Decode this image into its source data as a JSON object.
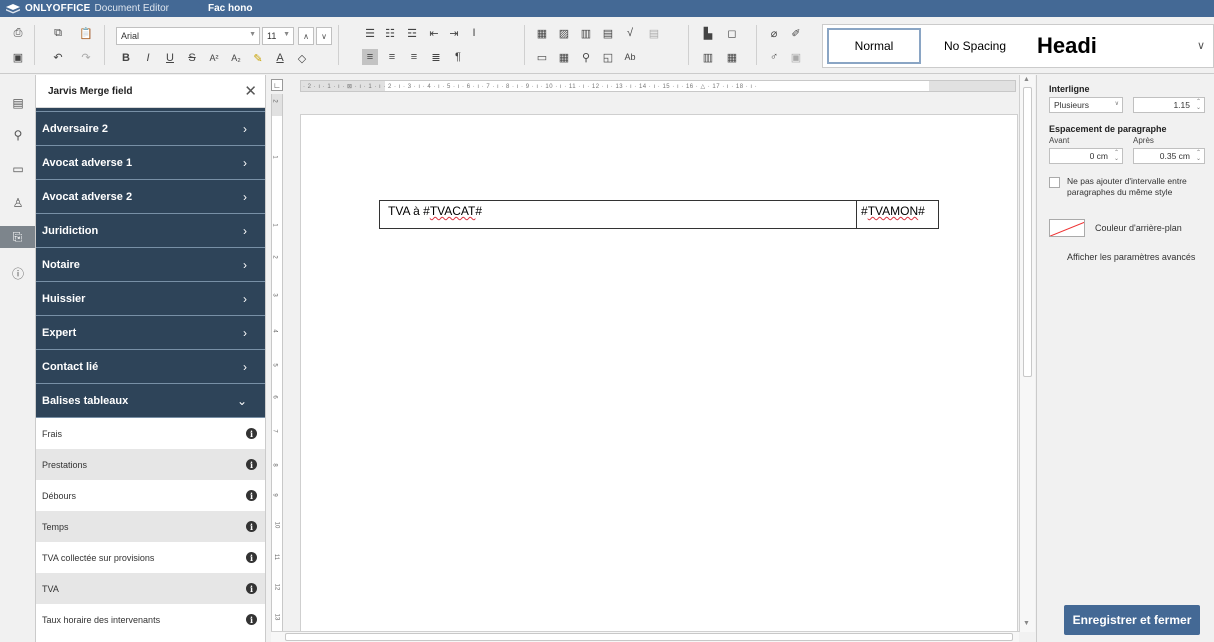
{
  "titlebar": {
    "brand": "ONLYOFFICE",
    "product": "Document Editor",
    "document": "Fac hono"
  },
  "toolbar": {
    "font_name": "Arial",
    "font_size": "11",
    "styles": {
      "normal": "Normal",
      "no_spacing": "No Spacing",
      "heading": "Headi"
    }
  },
  "panel": {
    "title": "Jarvis Merge field",
    "groups": [
      "Adversaire 2",
      "Avocat adverse 1",
      "Avocat adverse 2",
      "Juridiction",
      "Notaire",
      "Huissier",
      "Expert",
      "Contact lié"
    ],
    "expanded_group": "Balises tableaux",
    "items": [
      "Frais",
      "Prestations",
      "Débours",
      "Temps",
      "TVA collectée sur provisions",
      "TVA",
      "Taux horaire des intervenants"
    ]
  },
  "document": {
    "cell1_prefix": "TVA à #",
    "cell1_field": "TVACAT",
    "cell1_suffix": "#",
    "cell2_prefix": "#",
    "cell2_field": "TVAMON",
    "cell2_suffix": "#"
  },
  "ruler": {
    "h_ticks": "· 2 · ı · 1 · ı · ⊠ · ı · 1 · ı · 2 · ı · 3 · ı · 4 · ı · 5 · ı · 6 · ı · 7 · ı · 8 · ı · 9 · ı · 10 · ı · 11 · ı · 12 · ı · 13 · ı · 14 · ı · 15 · ı · 16 · △ · 17 · ı · 18 · ı ·",
    "v_ticks": [
      "2",
      "1",
      "1",
      "2",
      "3",
      "4",
      "5",
      "6",
      "7",
      "8",
      "9",
      "10",
      "11",
      "12",
      "13"
    ]
  },
  "right_panel": {
    "line_spacing_label": "Interligne",
    "line_spacing_mode": "Plusieurs",
    "line_spacing_value": "1.15",
    "paragraph_spacing_label": "Espacement de paragraphe",
    "before_label": "Avant",
    "after_label": "Après",
    "before_value": "0 cm",
    "after_value": "0.35 cm",
    "no_interval_label": "Ne pas ajouter d'intervalle entre paragraphes du même style",
    "background_color_label": "Couleur d'arrière-plan",
    "advanced_link": "Afficher les paramètres avancés",
    "save_button": "Enregistrer et fermer"
  },
  "colors": {
    "accent": "#446995",
    "panel_dark": "#2e4459",
    "spell_error": "#d9333f"
  }
}
